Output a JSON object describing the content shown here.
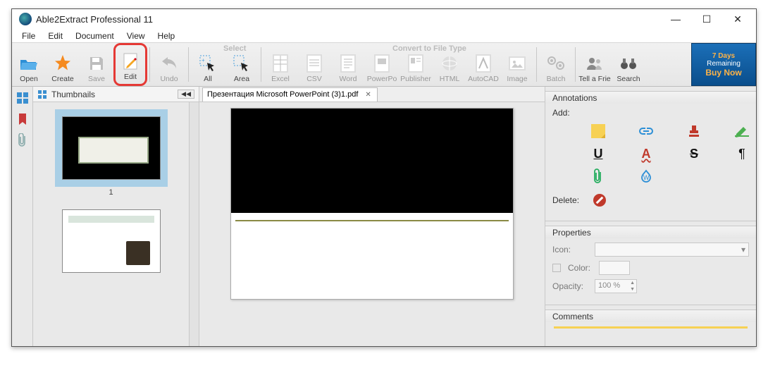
{
  "window": {
    "title": "Able2Extract Professional 11"
  },
  "menu": {
    "file": "File",
    "edit": "Edit",
    "document": "Document",
    "view": "View",
    "help": "Help"
  },
  "toolbar": {
    "open": "Open",
    "create": "Create",
    "save": "Save",
    "edit": "Edit",
    "undo": "Undo",
    "all": "All",
    "area": "Area",
    "excel": "Excel",
    "csv": "CSV",
    "word": "Word",
    "powerpo": "PowerPo",
    "publisher": "Publisher",
    "html": "HTML",
    "autocad": "AutoCAD",
    "image": "Image",
    "batch": "Batch",
    "tell": "Tell a Frie",
    "search": "Search",
    "group_select": "Select",
    "group_convert": "Convert to File Type"
  },
  "promo": {
    "days": "7 Days",
    "remaining": "Remaining",
    "buy": "Buy Now"
  },
  "thumbs": {
    "title": "Thumbnails",
    "page1": "1"
  },
  "doc": {
    "tab": "Презентация Microsoft PowerPoint (3)1.pdf"
  },
  "annotations": {
    "title": "Annotations",
    "add": "Add:",
    "delete": "Delete:"
  },
  "properties": {
    "title": "Properties",
    "icon_label": "Icon:",
    "color_label": "Color:",
    "opacity_label": "Opacity:",
    "opacity_value": "100 %"
  },
  "comments": {
    "title": "Comments"
  }
}
